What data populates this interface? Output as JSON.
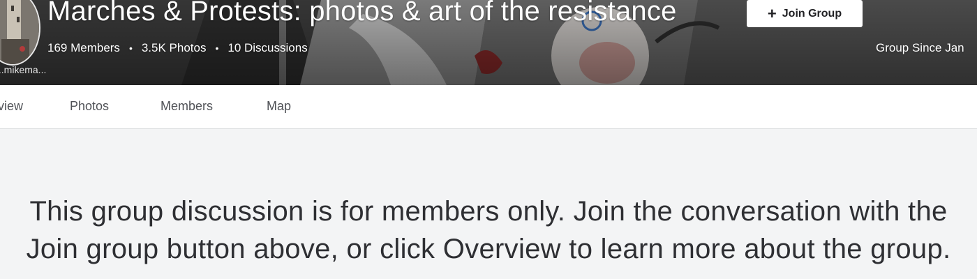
{
  "group": {
    "title": "Marches & Protests: photos & art of the resistance",
    "join_label": "Join Group",
    "owner_name": "...mikema...",
    "stats": {
      "members": "169 Members",
      "separator_1": "•",
      "photos": "3.5K Photos",
      "separator_2": "•",
      "discussions": "10 Discussions"
    },
    "group_since": "Group Since Jan"
  },
  "tabs": [
    {
      "label": "Overview"
    },
    {
      "label": "Photos"
    },
    {
      "label": "Members"
    },
    {
      "label": "Map"
    }
  ],
  "notice": {
    "text": "This group discussion is for members only. Join the conversation with the Join group button above, or click Overview to learn more about the group."
  },
  "icons": {
    "join": "plus-icon"
  },
  "colors": {
    "page_background": "#f3f4f5",
    "tab_background": "#ffffff",
    "banner_text": "#ffffff"
  }
}
